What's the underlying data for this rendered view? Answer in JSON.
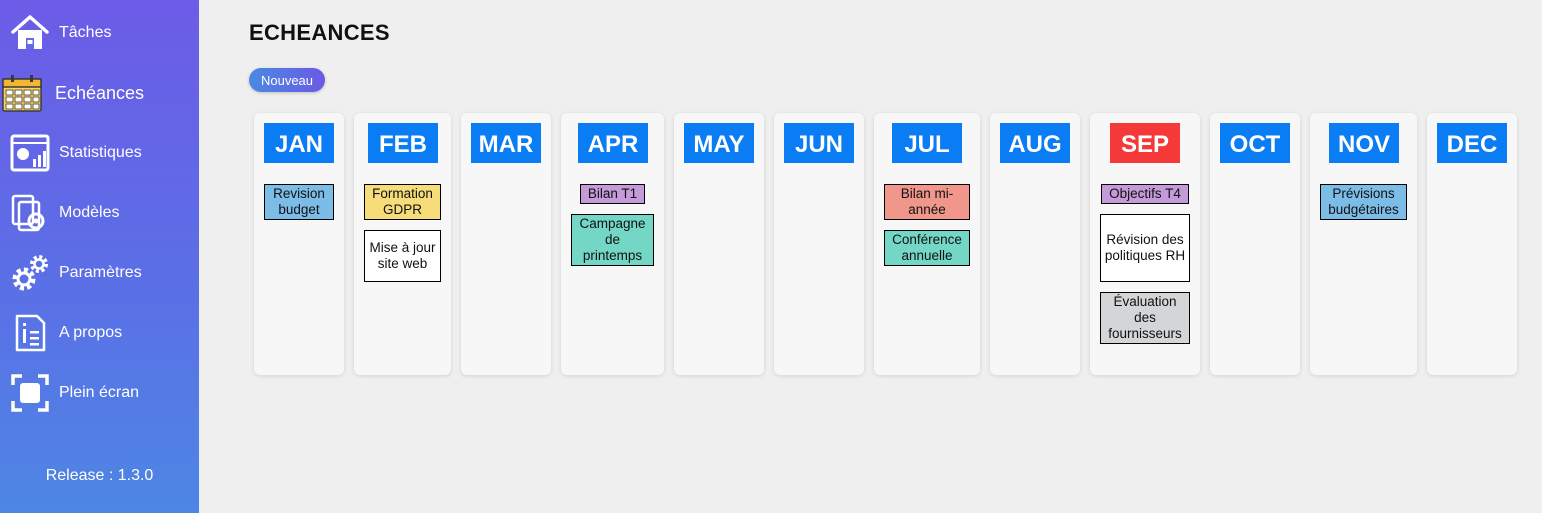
{
  "sidebar": {
    "items": [
      {
        "label": "Tâches",
        "icon": "home-icon"
      },
      {
        "label": "Echéances",
        "icon": "calendar-icon"
      },
      {
        "label": "Statistiques",
        "icon": "statistics-icon"
      },
      {
        "label": "Modèles",
        "icon": "templates-icon"
      },
      {
        "label": "Paramètres",
        "icon": "settings-icon"
      },
      {
        "label": "A propos",
        "icon": "info-icon"
      },
      {
        "label": "Plein écran",
        "icon": "fullscreen-icon"
      }
    ],
    "active": "Echéances",
    "release": "Release : 1.3.0"
  },
  "main": {
    "title": "ECHEANCES",
    "new_button": "Nouveau"
  },
  "colors": {
    "month_header": "#0a7df5",
    "month_header_current": "#f53838",
    "blue": "#7cbde8",
    "yellow": "#f7dc7a",
    "white": "#ffffff",
    "purple": "#c49ad8",
    "teal": "#74d6c5",
    "salmon": "#f0968a",
    "gray": "#d3d5d7"
  },
  "months": [
    {
      "name": "JAN",
      "events": [
        {
          "text": "Revision budget",
          "color": "blue"
        }
      ]
    },
    {
      "name": "FEB",
      "events": [
        {
          "text": "Formation GDPR",
          "color": "yellow"
        },
        {
          "text": "Mise à jour site web",
          "color": "white"
        }
      ]
    },
    {
      "name": "MAR",
      "events": []
    },
    {
      "name": "APR",
      "events": [
        {
          "text": "Bilan T1",
          "color": "purple"
        },
        {
          "text": "Campagne de printemps",
          "color": "teal"
        }
      ]
    },
    {
      "name": "MAY",
      "events": []
    },
    {
      "name": "JUN",
      "events": []
    },
    {
      "name": "JUL",
      "events": [
        {
          "text": "Bilan mi-année",
          "color": "salmon"
        },
        {
          "text": "Conférence annuelle",
          "color": "teal"
        }
      ]
    },
    {
      "name": "AUG",
      "events": []
    },
    {
      "name": "SEP",
      "current": true,
      "events": [
        {
          "text": "Objectifs T4",
          "color": "purple"
        },
        {
          "text": "Révision des politiques RH",
          "color": "white"
        },
        {
          "text": "Évaluation des fournisseurs",
          "color": "gray"
        }
      ]
    },
    {
      "name": "OCT",
      "events": []
    },
    {
      "name": "NOV",
      "events": [
        {
          "text": "Prévisions budgétaires",
          "color": "blue"
        }
      ]
    },
    {
      "name": "DEC",
      "events": []
    }
  ]
}
